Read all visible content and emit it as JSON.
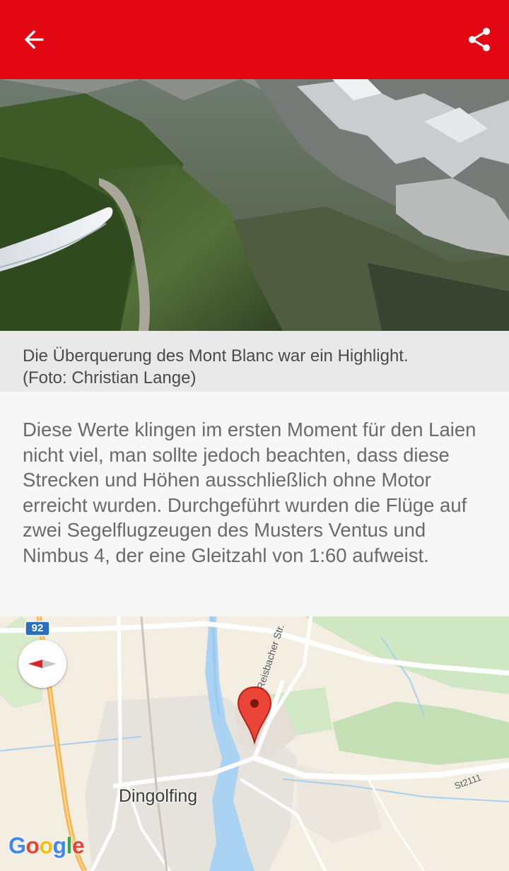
{
  "toolbar": {
    "back_icon": "arrow-back-icon",
    "share_icon": "share-icon",
    "color": "#e30613"
  },
  "photo": {
    "subject": "Glider wing over Mont Blanc valley"
  },
  "caption": {
    "line1": "Die Überquerung des Mont Blanc war ein Highlight.",
    "line2": "(Foto: Christian Lange)"
  },
  "article": {
    "paragraph": "Diese Werte klingen im ersten Moment für den Laien nicht viel, man sollte jedoch beachten, dass diese Strecken und Höhen ausschließlich ohne Motor erreicht wurden. Durchgeführt wurden die Flüge auf zwei Segelflugzeugen des Musters Ventus und Nimbus 4, der eine Gleitzahl von 1:60 aufweist."
  },
  "map": {
    "highway_shield": "92",
    "city": "Dingolfing",
    "street": "Reisbacher Str.",
    "road_code": "St2111",
    "logo": "Google",
    "compass_icon": "compass-icon",
    "marker_icon": "map-pin-icon"
  }
}
